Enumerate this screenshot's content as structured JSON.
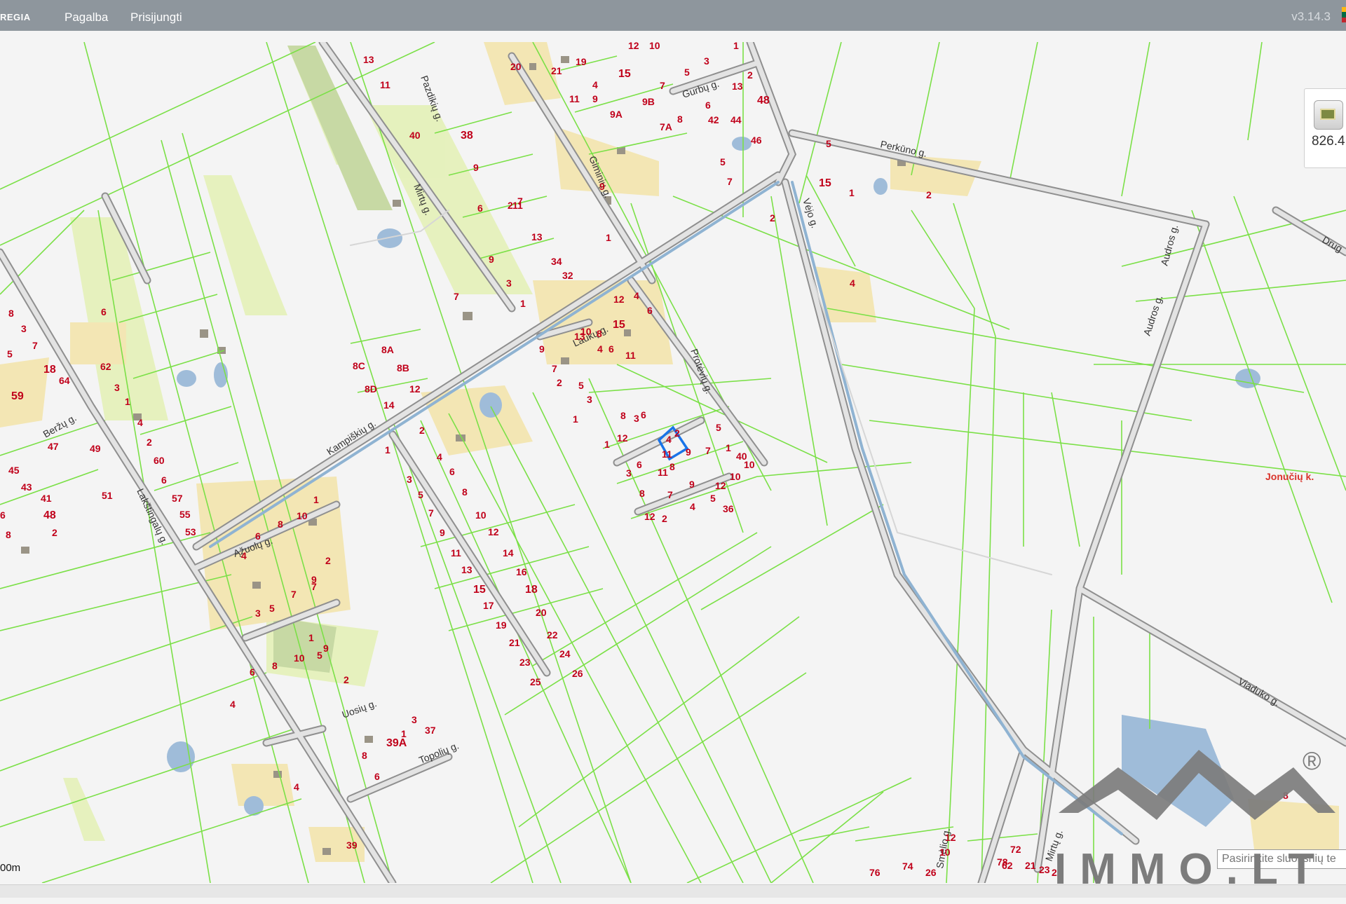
{
  "topbar": {
    "brand": "REGIA",
    "menu": [
      {
        "label": "Pagalba"
      },
      {
        "label": "Prisijungti"
      }
    ],
    "version": "v3.14.3"
  },
  "colors": {
    "topbar": "#8e969d",
    "parcel_line": "#7be047",
    "road_fill": "#e3e3e3",
    "road_edge": "#8f8f8f",
    "water": "#9fbcd9",
    "building": "#c2b79a",
    "garden": "#e4f1b8",
    "house_number": "#c0001a",
    "selected_parcel": "#1a74e8",
    "logo_gray": "#7c7c7c"
  },
  "layer_widget": {
    "icon": "layers-icon",
    "value": "826.4"
  },
  "scale": {
    "label": "00m"
  },
  "layer_search": {
    "placeholder": "Pasirinkite sluoksnių te"
  },
  "watermark": {
    "text": "IMMO.LT",
    "registered": "®"
  },
  "streets": [
    {
      "label": "Perkūno g."
    },
    {
      "label": "Vėjo g."
    },
    {
      "label": "Audros g."
    },
    {
      "label": "Audros g."
    },
    {
      "label": "Drug"
    },
    {
      "label": "Viaduko g."
    },
    {
      "label": "Kampiškių g."
    },
    {
      "label": "Laukų g."
    },
    {
      "label": "Protėvių g."
    },
    {
      "label": "Giminių g."
    },
    {
      "label": "Gurbų g."
    },
    {
      "label": "Mirtų g."
    },
    {
      "label": "Pazdikių g."
    },
    {
      "label": "Lakštingalų g."
    },
    {
      "label": "Beržų g."
    },
    {
      "label": "Ąžuolų g."
    },
    {
      "label": "Uosių g."
    },
    {
      "label": "Topolių g."
    },
    {
      "label": "Mirtų g."
    },
    {
      "label": "Jonučių k."
    },
    {
      "label": "Smėlio g."
    }
  ],
  "house_numbers": [
    "13",
    "11",
    "12",
    "10",
    "1",
    "3",
    "20",
    "21",
    "19",
    "15",
    "5",
    "2",
    "4",
    "13",
    "7",
    "6",
    "48",
    "11",
    "9",
    "9A",
    "9B",
    "8",
    "44",
    "7A",
    "42",
    "46",
    "5",
    "7",
    "40",
    "38",
    "9",
    "7",
    "6",
    "2",
    "1",
    "9",
    "9",
    "7",
    "11",
    "13",
    "34",
    "32",
    "3",
    "1",
    "5",
    "15",
    "2",
    "1",
    "2",
    "4",
    "6",
    "8",
    "3",
    "5",
    "7",
    "18",
    "59",
    "64",
    "62",
    "3",
    "1",
    "4",
    "2",
    "60",
    "6",
    "57",
    "55",
    "53",
    "51",
    "49",
    "47",
    "45",
    "43",
    "41",
    "48",
    "2",
    "6",
    "8",
    "8A",
    "8B",
    "8C",
    "8D",
    "12",
    "14",
    "12",
    "4",
    "6",
    "10",
    "8",
    "15",
    "13",
    "11",
    "6",
    "4",
    "9",
    "7",
    "5",
    "2",
    "1",
    "3",
    "8",
    "12",
    "3",
    "5",
    "1",
    "7",
    "4",
    "2",
    "9",
    "8",
    "6",
    "3",
    "1",
    "11",
    "10",
    "12",
    "9",
    "7",
    "5",
    "4",
    "2",
    "6",
    "11",
    "10",
    "8",
    "12",
    "2",
    "4",
    "6",
    "8",
    "10",
    "12",
    "14",
    "16",
    "18",
    "20",
    "22",
    "24",
    "26",
    "1",
    "3",
    "5",
    "7",
    "9",
    "11",
    "13",
    "15",
    "17",
    "19",
    "21",
    "23",
    "25",
    "1",
    "10",
    "8",
    "6",
    "4",
    "2",
    "9",
    "7",
    "5",
    "3",
    "1",
    "10",
    "8",
    "6",
    "4",
    "2",
    "9",
    "7",
    "5",
    "3",
    "1",
    "39A",
    "8",
    "6",
    "4",
    "39",
    "37",
    "40",
    "36",
    "8",
    "12",
    "10",
    "26",
    "76",
    "74",
    "72",
    "62",
    "78",
    "21",
    "23",
    "22",
    "20",
    "14",
    "12"
  ]
}
